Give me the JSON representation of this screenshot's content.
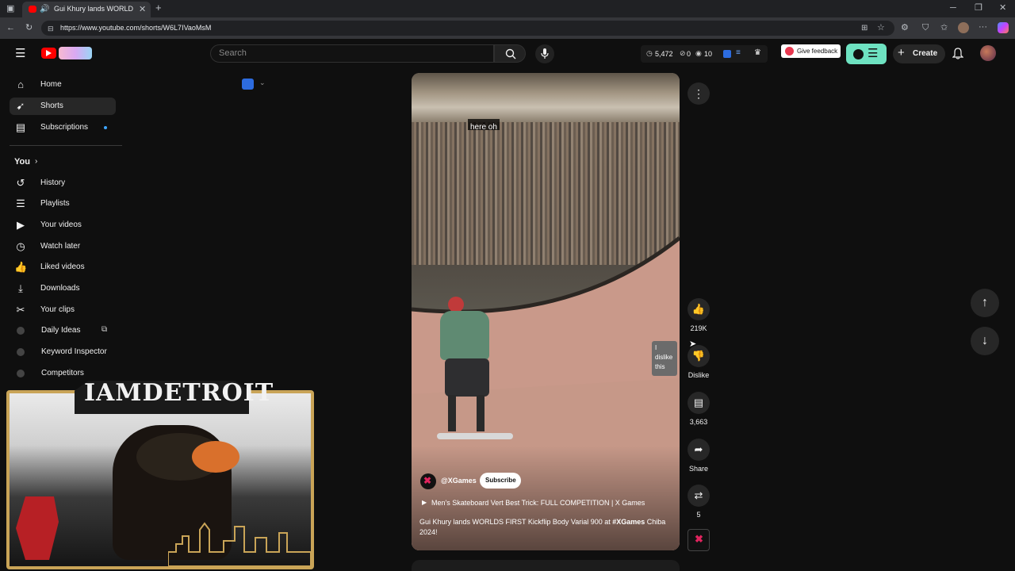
{
  "browser": {
    "tab_title": "Gui Khury lands WORLDS FIRST",
    "url": "https://www.youtube.com/shorts/W6L7IVaoMsM"
  },
  "header": {
    "search_placeholder": "Search",
    "stats": {
      "views": "5,472",
      "a": "0",
      "b": "10"
    },
    "give_feedback": "Give feedback",
    "create_label": "Create"
  },
  "sidebar": {
    "main": [
      {
        "label": "Home",
        "icon": "home-icon"
      },
      {
        "label": "Shorts",
        "icon": "shorts-icon"
      },
      {
        "label": "Subscriptions",
        "icon": "subscriptions-icon"
      }
    ],
    "you_label": "You",
    "you_items": [
      {
        "label": "History",
        "icon": "history-icon"
      },
      {
        "label": "Playlists",
        "icon": "playlists-icon"
      },
      {
        "label": "Your videos",
        "icon": "your-videos-icon"
      },
      {
        "label": "Watch later",
        "icon": "watch-later-icon"
      },
      {
        "label": "Liked videos",
        "icon": "liked-videos-icon"
      },
      {
        "label": "Downloads",
        "icon": "downloads-icon"
      },
      {
        "label": "Your clips",
        "icon": "clips-icon"
      },
      {
        "label": "Daily Ideas",
        "icon": "vidiq-icon"
      },
      {
        "label": "Keyword Inspector",
        "icon": "vidiq-icon"
      },
      {
        "label": "Competitors",
        "icon": "vidiq-icon"
      }
    ]
  },
  "video": {
    "caption": "here oh",
    "channel": "@XGames",
    "subscribe_label": "Subscribe",
    "playlist_title": "Men's Skateboard Vert Best Trick: FULL COMPETITION | X Games",
    "description_pre": "Gui Khury lands WORLDS FIRST Kickflip Body Varial 900 at ",
    "description_hashtag": "#XGames",
    "description_post": " Chiba 2024!"
  },
  "actions": {
    "likes": "219K",
    "dislike_label": "Dislike",
    "tooltip_l1": "I",
    "tooltip_l2": "dislike",
    "tooltip_l3": "this",
    "comments": "3,663",
    "share_label": "Share",
    "remix_count": "5"
  },
  "overlay": {
    "webcam_banner": "IAMDETROIT"
  },
  "colors": {
    "bg": "#0f0f0f",
    "accent_red": "#ff0000",
    "vidiq_green": "#6ee2c1",
    "vidiq_blue": "#2d6cdf"
  }
}
